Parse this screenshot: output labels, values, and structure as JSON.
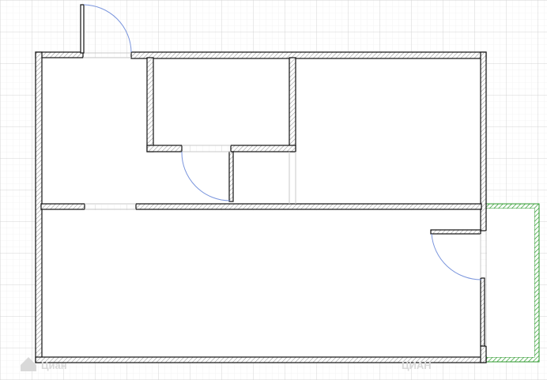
{
  "plan": {
    "grid_minor_color": "#ebebeb",
    "grid_major_color": "#d4d4d4",
    "wall_color": "#111111",
    "wall_hatch_color": "#9a9a9a",
    "door_arc_color": "#7a95dd",
    "balcony_color": "#2e9a2e",
    "opening_line_color": "#c8c8c8"
  },
  "rooms": [
    {
      "name": "hall"
    },
    {
      "name": "bathroom"
    },
    {
      "name": "kitchen"
    },
    {
      "name": "living-room"
    },
    {
      "name": "balcony"
    }
  ],
  "doors": [
    {
      "name": "entrance-door"
    },
    {
      "name": "bathroom-door"
    },
    {
      "name": "balcony-door"
    }
  ],
  "watermarks": {
    "left_logo": "",
    "left_text": "Циан",
    "right_text": "ЦИАН"
  }
}
